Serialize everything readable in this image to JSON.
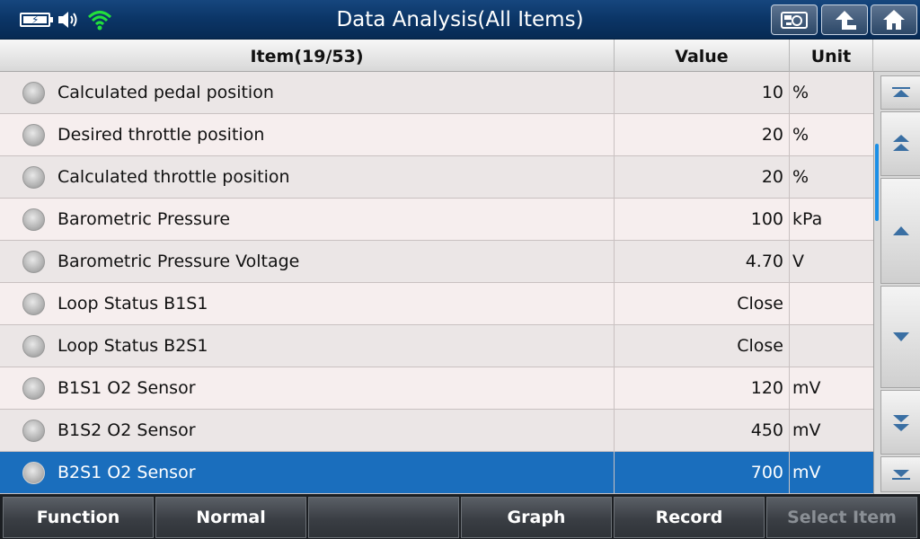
{
  "window": {
    "title": "Data Analysis(All Items)"
  },
  "status_icons": [
    "battery-icon",
    "speaker-icon",
    "wifi-icon"
  ],
  "top_buttons": [
    "camera-icon",
    "back-arrow-icon",
    "home-icon"
  ],
  "table": {
    "headers": {
      "item": "Item(19/53)",
      "value": "Value",
      "unit": "Unit"
    },
    "rows": [
      {
        "name": "Calculated pedal position",
        "value": "10",
        "unit": "%"
      },
      {
        "name": "Desired throttle position",
        "value": "20",
        "unit": "%"
      },
      {
        "name": "Calculated throttle position",
        "value": "20",
        "unit": "%"
      },
      {
        "name": "Barometric Pressure",
        "value": "100",
        "unit": "kPa"
      },
      {
        "name": "Barometric Pressure Voltage",
        "value": "4.70",
        "unit": "V"
      },
      {
        "name": "Loop Status B1S1",
        "value": "Close",
        "unit": ""
      },
      {
        "name": "Loop Status B2S1",
        "value": "Close",
        "unit": ""
      },
      {
        "name": "B1S1 O2 Sensor",
        "value": "120",
        "unit": "mV"
      },
      {
        "name": "B1S2 O2 Sensor",
        "value": "450",
        "unit": "mV"
      },
      {
        "name": "B2S1 O2 Sensor",
        "value": "700",
        "unit": "mV",
        "selected": true
      }
    ]
  },
  "scroll_buttons": [
    "scroll-top-icon",
    "page-up-icon",
    "line-up-icon",
    "line-down-icon",
    "page-down-icon",
    "scroll-bottom-icon"
  ],
  "bottom_buttons": {
    "function": "Function",
    "normal": "Normal",
    "empty": "",
    "graph": "Graph",
    "record": "Record",
    "select_item": "Select Item"
  },
  "colors": {
    "titlebar": "#0b3566",
    "selected_row": "#1a6ebd",
    "wifi": "#22e03c"
  }
}
